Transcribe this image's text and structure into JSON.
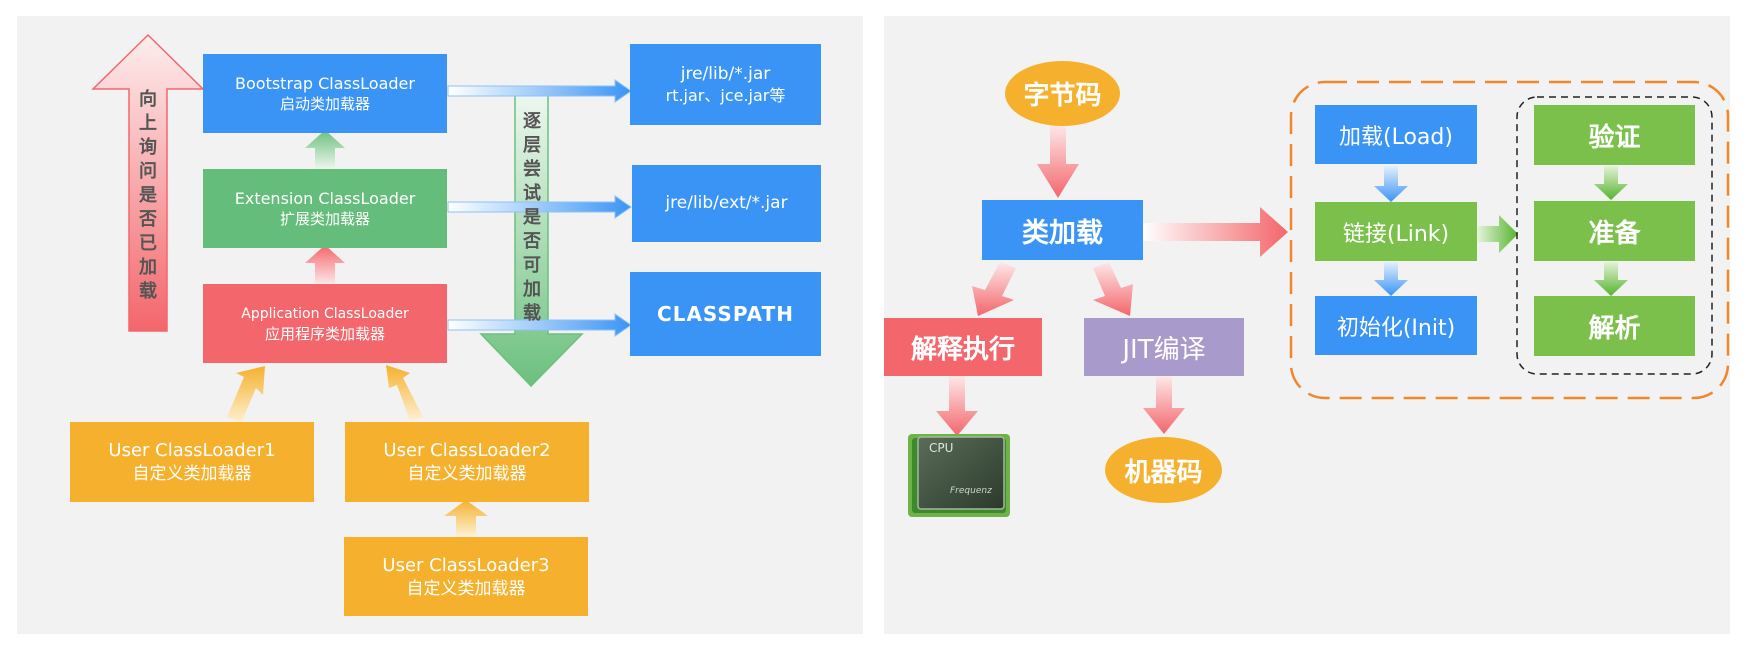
{
  "left": {
    "bootstrap": {
      "line1": "Bootstrap ClassLoader",
      "line2": "启动类加载器"
    },
    "extension": {
      "line1": "Extension ClassLoader",
      "line2": "扩展类加载器"
    },
    "application": {
      "line1": "Application ClassLoader",
      "line2": "应用程序类加载器"
    },
    "user1": {
      "line1": "User ClassLoader1",
      "line2": "自定义类加载器"
    },
    "user2": {
      "line1": "User ClassLoader2",
      "line2": "自定义类加载器"
    },
    "user3": {
      "line1": "User ClassLoader3",
      "line2": "自定义类加载器"
    },
    "path_jre": {
      "line1": "jre/lib/*.jar",
      "line2": "rt.jar、jce.jar等"
    },
    "path_ext": {
      "line1": "jre/lib/ext/*.jar"
    },
    "path_classpath": {
      "line1": "CLASSPATH"
    },
    "up_arrow_text": "向上询问是否已加载",
    "down_arrow_text": "逐层尝试是否可加载"
  },
  "right": {
    "bytecode": "字节码",
    "class_loading": "类加载",
    "interpret": "解释执行",
    "jit": "JIT编译",
    "machine_code": "机器码",
    "cpu": {
      "label": "CPU",
      "brand": "Frequenz"
    },
    "load": "加载(Load)",
    "link": "链接(Link)",
    "init": "初始化(Init)",
    "verify": "验证",
    "prepare": "准备",
    "resolve": "解析"
  }
}
